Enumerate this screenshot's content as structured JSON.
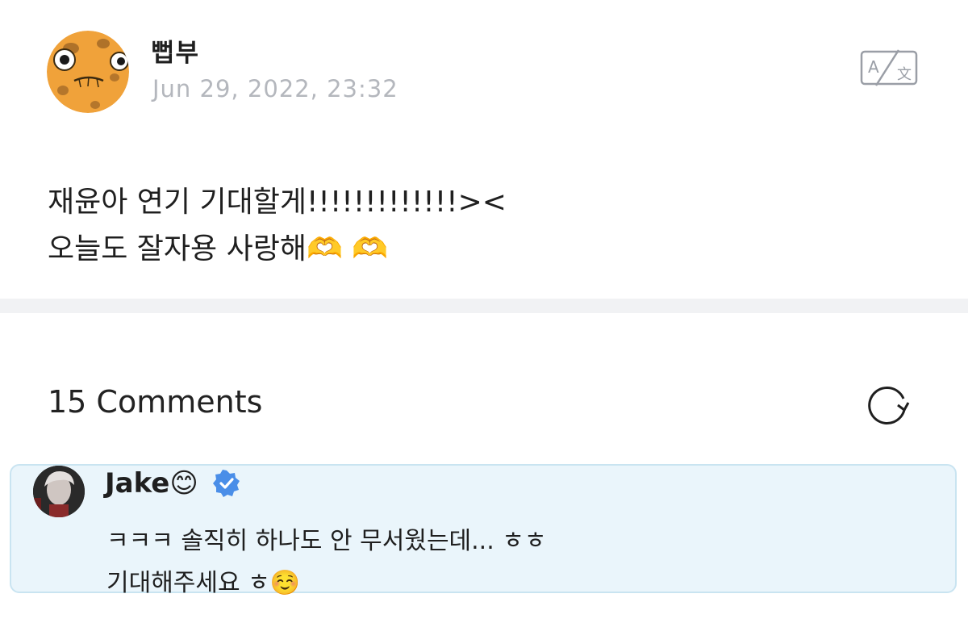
{
  "post": {
    "author_name": "뻡부",
    "date": "Jun 29, 2022, 23:32",
    "body": "재윤아 연기 기대할게!!!!!!!!!!!!!><\n오늘도 잘자용 사랑해🫶 🫶",
    "avatar_icon": "cartoon-face-avatar",
    "translate_icon": "translate-icon"
  },
  "comments": {
    "title": "15 Comments",
    "refresh_icon": "refresh-icon"
  },
  "comment": {
    "author_name": "Jake😊",
    "verified_icon": "verified-badge-icon",
    "text": "ㅋㅋㅋ 솔직히 하나도 안 무서웠는데... ㅎㅎ\n기대해주세요 ㅎ☺️",
    "highlight_bg": "#eaf5fb",
    "highlight_border": "#c9e4f1",
    "verified_color": "#4a8ee8"
  }
}
